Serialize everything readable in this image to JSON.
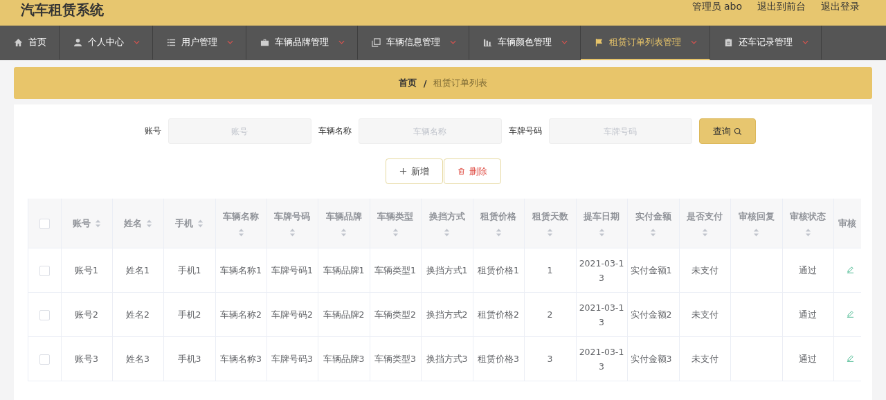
{
  "header": {
    "title": "汽车租赁系统",
    "user": "管理员 abo",
    "links": [
      "退出到前台",
      "退出登录"
    ]
  },
  "nav": [
    {
      "label": "首页",
      "dropdown": false,
      "selected": false
    },
    {
      "label": "个人中心",
      "dropdown": true,
      "selected": false
    },
    {
      "label": "用户管理",
      "dropdown": true,
      "selected": false
    },
    {
      "label": "车辆品牌管理",
      "dropdown": true,
      "selected": false
    },
    {
      "label": "车辆信息管理",
      "dropdown": true,
      "selected": false
    },
    {
      "label": "车辆颜色管理",
      "dropdown": true,
      "selected": false
    },
    {
      "label": "租赁订单列表管理",
      "dropdown": true,
      "selected": true
    },
    {
      "label": "还车记录管理",
      "dropdown": true,
      "selected": false
    }
  ],
  "breadcrumb": {
    "home": "首页",
    "separator": "/",
    "current": "租赁订单列表"
  },
  "search": {
    "fields": [
      {
        "label": "账号",
        "placeholder": "账号"
      },
      {
        "label": "车辆名称",
        "placeholder": "车辆名称"
      },
      {
        "label": "车牌号码",
        "placeholder": "车牌号码"
      }
    ],
    "button": "查询"
  },
  "actions": {
    "add": "新增",
    "delete": "删除"
  },
  "table": {
    "header_checked": false,
    "columns": [
      "账号",
      "姓名",
      "手机",
      "车辆名称",
      "车牌号码",
      "车辆品牌",
      "车辆类型",
      "换挡方式",
      "租赁价格",
      "租赁天数",
      "提车日期",
      "实付金额",
      "是否支付",
      "审核回复",
      "审核状态",
      "审核"
    ],
    "rows": [
      {
        "checked": false,
        "cells": [
          "账号1",
          "姓名1",
          "手机1",
          "车辆名称1",
          "车牌号码1",
          "车辆品牌1",
          "车辆类型1",
          "换挡方式1",
          "租赁价格1",
          "1",
          "2021-03-13",
          "实付金额1",
          "未支付",
          "",
          "通过"
        ]
      },
      {
        "checked": false,
        "cells": [
          "账号2",
          "姓名2",
          "手机2",
          "车辆名称2",
          "车牌号码2",
          "车辆品牌2",
          "车辆类型2",
          "换挡方式2",
          "租赁价格2",
          "2",
          "2021-03-13",
          "实付金额2",
          "未支付",
          "",
          "通过"
        ]
      },
      {
        "checked": false,
        "cells": [
          "账号3",
          "姓名3",
          "手机3",
          "车辆名称3",
          "车牌号码3",
          "车辆品牌3",
          "车辆类型3",
          "换挡方式3",
          "租赁价格3",
          "3",
          "2021-03-13",
          "实付金额3",
          "未支付",
          "",
          "通过"
        ]
      }
    ]
  }
}
